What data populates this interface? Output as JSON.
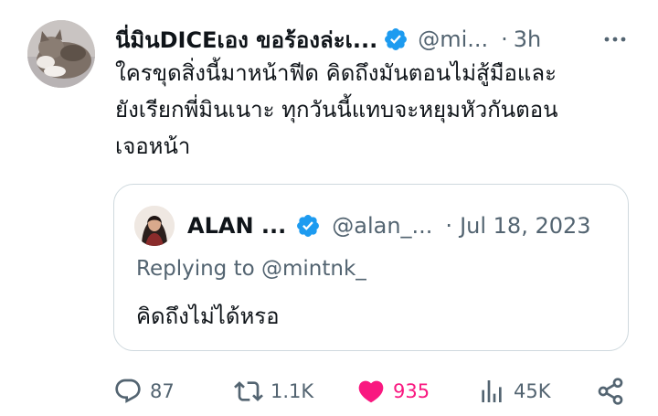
{
  "tweet": {
    "author": {
      "display_name": "นี่มินDICEเอง ขอร้องล่ะเ...",
      "handle": "@mi...",
      "verified_icon": "verified-badge-icon",
      "avatar_icon": "cat-avatar"
    },
    "separator": "·",
    "time": "3h",
    "text_lines": [
      "ใครขุดสิ่งนี้มาหน้าฟีด คิดถึงมันตอนไม่สู้มือและ",
      "ยังเรียกพี่มินเนาะ ทุกวันนี้แทบจะหยุมหัวกันตอน",
      "เจอหน้า"
    ]
  },
  "quote": {
    "author": {
      "display_name": "ALAN ...",
      "handle": "@alan_...",
      "verified_icon": "verified-badge-icon"
    },
    "separator": "·",
    "date": "Jul 18, 2023",
    "replying_to": "Replying to @mintnk_",
    "text": "คิดถึงไม่ได้หรอ"
  },
  "actions": {
    "reply": {
      "icon": "reply-icon",
      "count": "87"
    },
    "retweet": {
      "icon": "retweet-icon",
      "count": "1.1K"
    },
    "like": {
      "icon": "heart-filled-icon",
      "count": "935",
      "liked": true
    },
    "views": {
      "icon": "views-icon",
      "count": "45K"
    },
    "share": {
      "icon": "share-icon"
    }
  },
  "colors": {
    "text": "#0f1419",
    "muted": "#536471",
    "verified": "#1d9bf0",
    "like": "#f91880",
    "border": "#cfd9de"
  }
}
